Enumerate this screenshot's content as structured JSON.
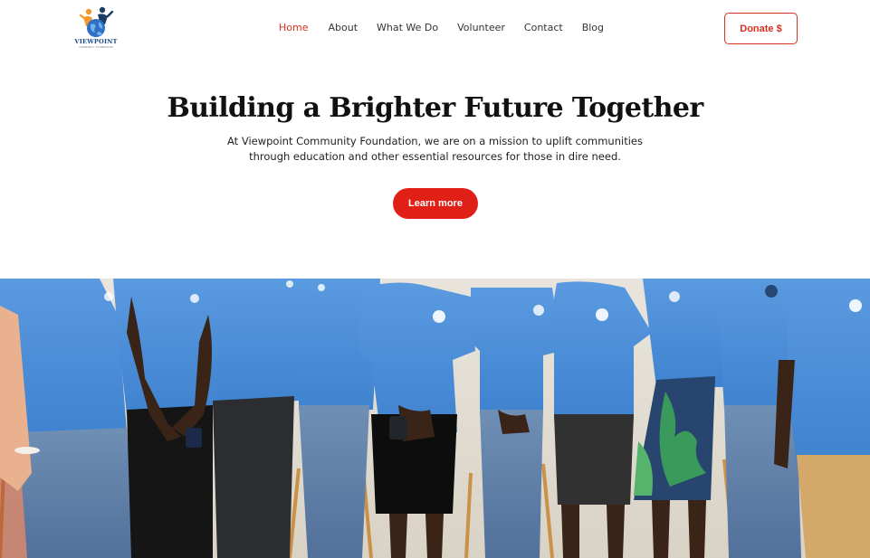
{
  "logo": {
    "wordmark": "VIEWPOINT",
    "tagline": "COMMUNITY FOUNDATION"
  },
  "nav": {
    "items": [
      {
        "label": "Home",
        "active": true
      },
      {
        "label": "About",
        "active": false
      },
      {
        "label": "What We Do",
        "active": false
      },
      {
        "label": "Volunteer",
        "active": false
      },
      {
        "label": "Contact",
        "active": false
      },
      {
        "label": "Blog",
        "active": false
      }
    ]
  },
  "header": {
    "donate_label": "Donate $"
  },
  "hero": {
    "title": "Building a Brighter Future Together",
    "text": "At Viewpoint Community Foundation, we are on a mission to uplift communities through education and other essential resources for those in dire need.",
    "cta_label": "Learn more"
  },
  "photo": {
    "subject": "group-photo-volunteers"
  },
  "colors": {
    "accent": "#e01f17",
    "nav_active": "#d9311f",
    "shirt_blue": "#4a8fd9"
  }
}
